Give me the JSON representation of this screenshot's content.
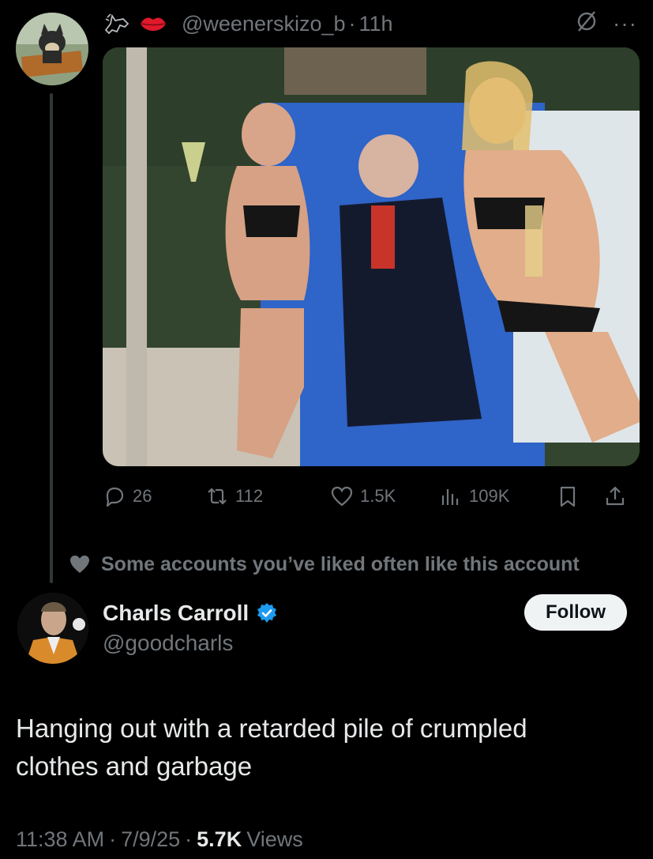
{
  "reply_parent": {
    "handle": "@weenerskizo_b",
    "separator": "·",
    "time": "11h",
    "more_label": "···",
    "icons": [
      "horse-emoji-icon",
      "lips-emoji-icon",
      "empty-set-icon"
    ],
    "stats": {
      "replies": "26",
      "reposts": "112",
      "likes": "1.5K",
      "views": "109K"
    }
  },
  "social_context": "Some accounts you’ve liked often like this account",
  "tweet": {
    "display_name": "Charls Carroll",
    "handle": "@goodcharls",
    "verified": true,
    "follow_label": "Follow",
    "text_line1": "Hanging out with a retarded pile of crumpled",
    "text_line2": "clothes and garbage",
    "time": "11:38 AM",
    "date": "7/9/25",
    "separator": "·",
    "views_count": "5.7K",
    "views_label": "Views"
  },
  "colors": {
    "background": "#000000",
    "text": "#e7e9ea",
    "muted": "#71767b",
    "verified": "#1d9bf0",
    "follow_bg": "#eff3f4"
  }
}
